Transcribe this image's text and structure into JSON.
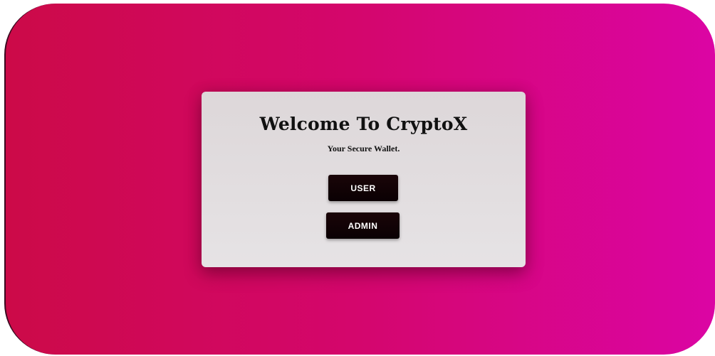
{
  "welcome": {
    "title": "Welcome To CryptoX",
    "subtitle": "Your Secure Wallet."
  },
  "buttons": {
    "user_label": "USER",
    "admin_label": "ADMIN"
  },
  "colors": {
    "background_gradient_start": "#cc0a48",
    "background_gradient_mid": "#d4066d",
    "background_gradient_end": "#db05a4",
    "card_background": "#e2dee0",
    "button_background": "#110305",
    "button_text": "#ffffff"
  }
}
